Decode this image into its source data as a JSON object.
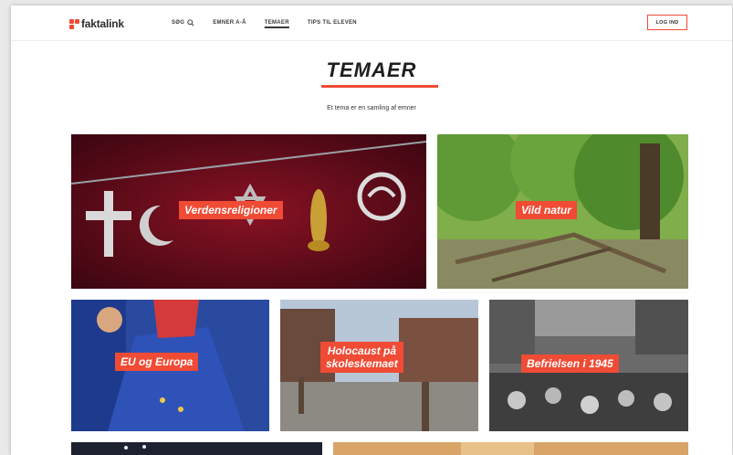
{
  "header": {
    "logo_text": "faktalink",
    "nav": [
      {
        "label": "SØG"
      },
      {
        "label": "EMNER A-Å"
      },
      {
        "label": "TEMAER"
      },
      {
        "label": "TIPS TIL ELEVEN"
      }
    ],
    "active_nav": "TEMAER",
    "login_label": "LOG IND"
  },
  "page": {
    "title": "TEMAER",
    "subtitle": "Et tema er en samling af emner"
  },
  "themes": [
    {
      "label": "Verdensreligioner"
    },
    {
      "label": "Vild natur"
    },
    {
      "label": "EU og Europa"
    },
    {
      "label_line1": "Holocaust på",
      "label_line2": "skoleskemaet"
    },
    {
      "label": "Befrielsen i 1945"
    }
  ],
  "colors": {
    "accent": "#ef4b35",
    "text": "#1e1e1e"
  },
  "icons": {
    "search": "search-icon",
    "logo": "faktalink-logo-icon"
  }
}
